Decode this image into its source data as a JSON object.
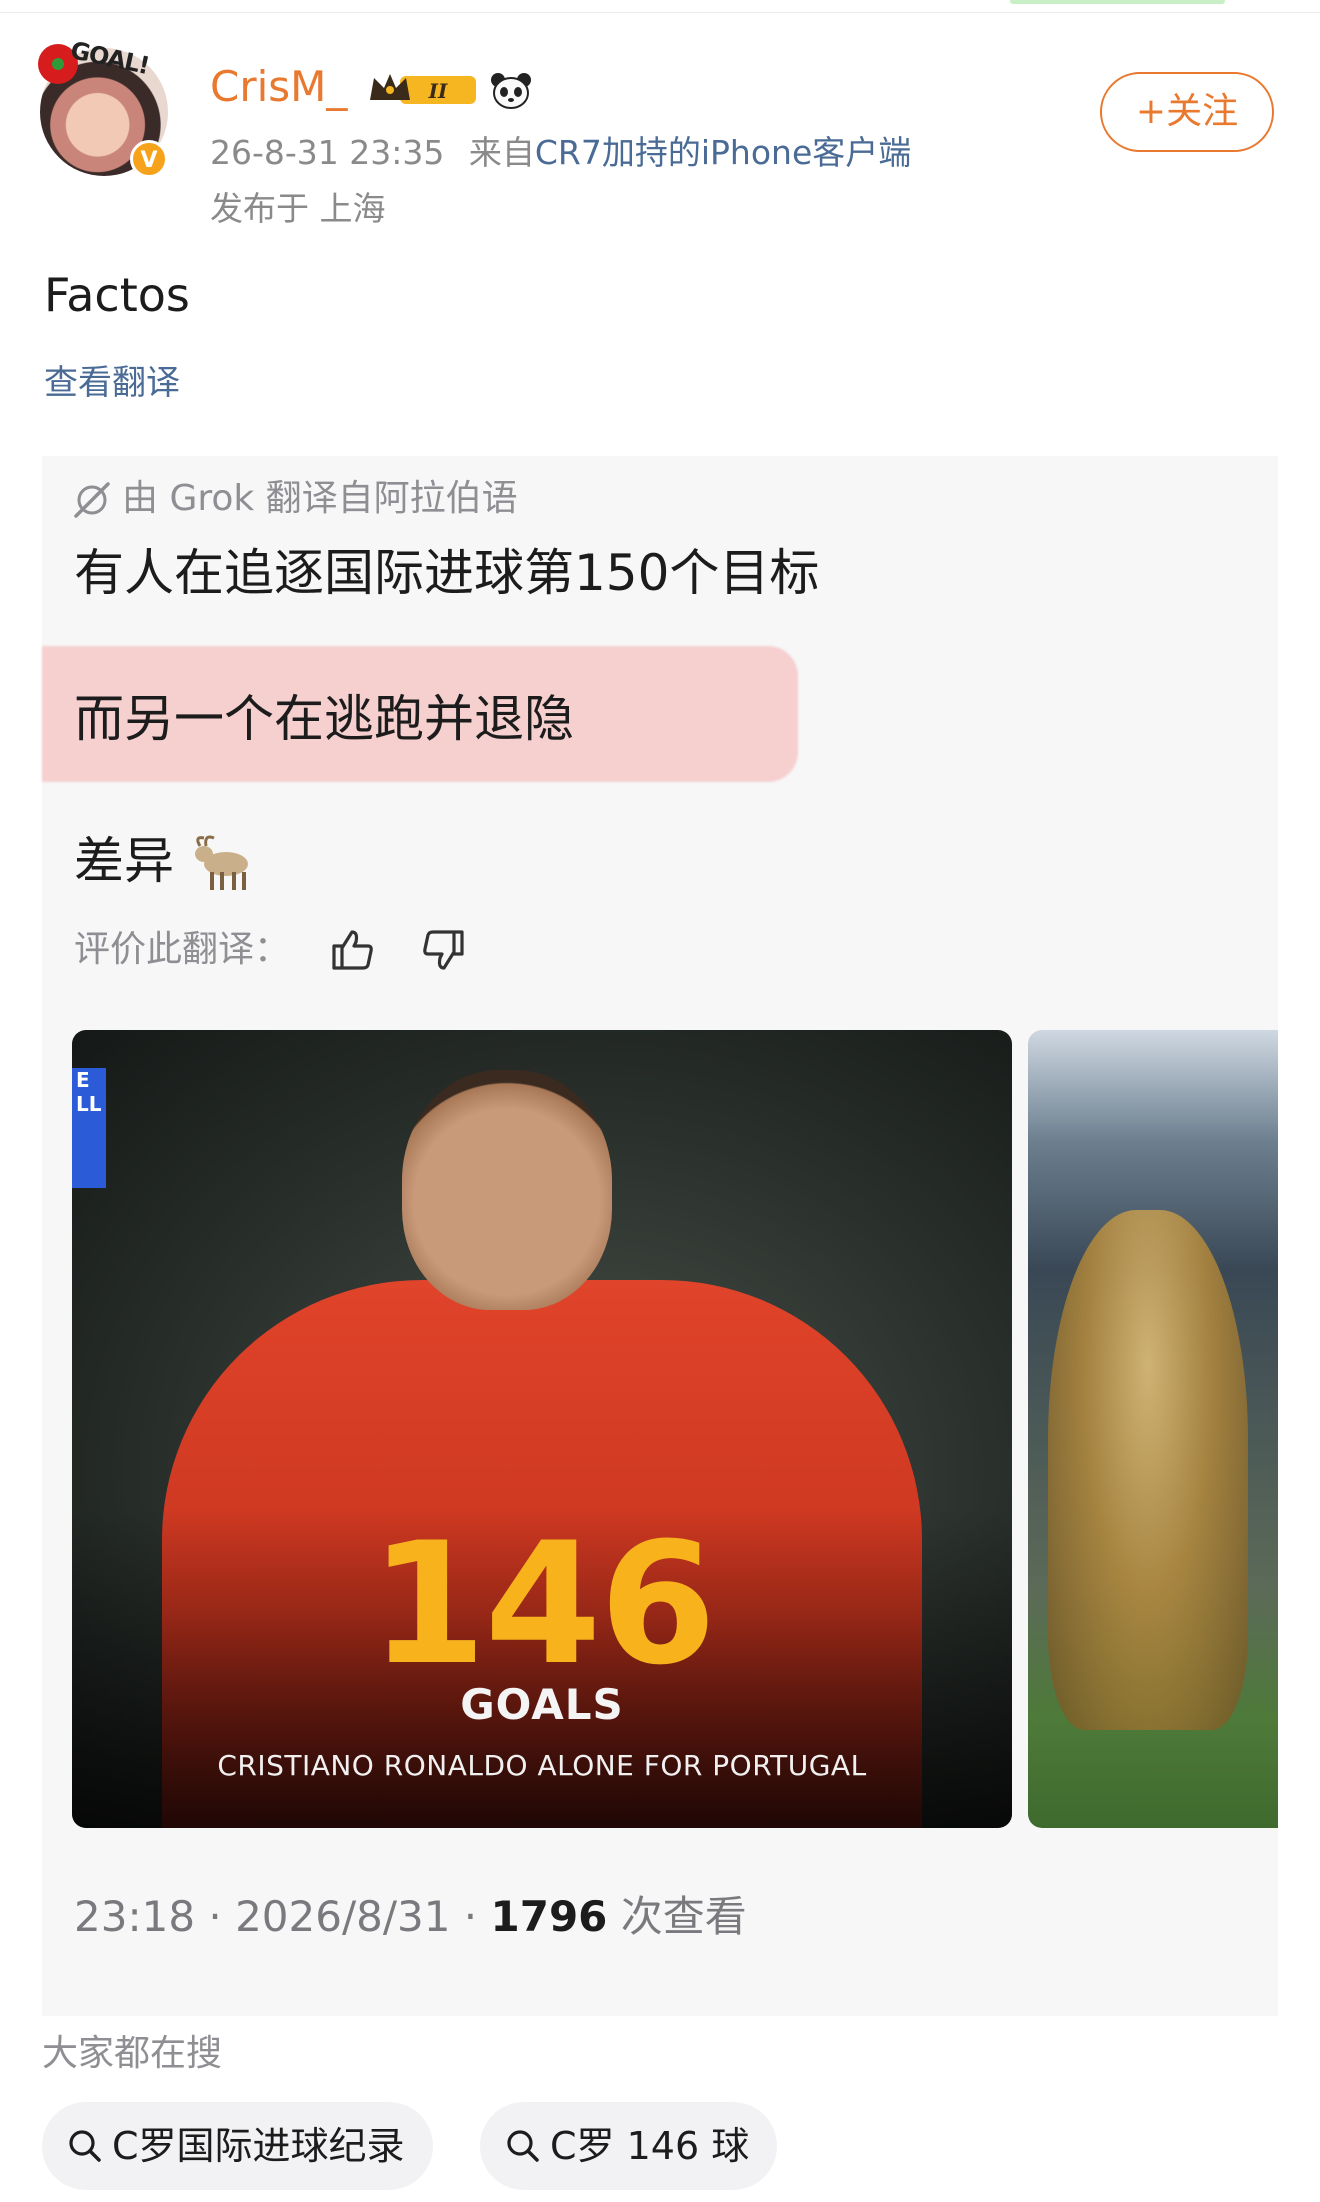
{
  "header": {
    "username": "CrisM_",
    "timestamp": "26-8-31 23:35",
    "source_prefix": "来自",
    "source": "CR7加持的iPhone客户端",
    "location": "发布于 上海",
    "follow_label": "+关注",
    "avatar_sticker": "GOAL!",
    "verified_badge": "V",
    "level_badge": "II"
  },
  "post": {
    "text": "Factos",
    "translate_link": "查看翻译"
  },
  "translation": {
    "source_line": "由 Grok 翻译自阿拉伯语",
    "line1": "有人在追逐国际进球第150个目标",
    "line2": "而另一个在逃跑并退隐",
    "line3": "差异",
    "rate_label": "评价此翻译："
  },
  "image": {
    "corner_tag": "E LL",
    "number": "146",
    "goals_label": "GOALS",
    "caption": "CRISTIANO RONALDO ALONE FOR PORTUGAL"
  },
  "stats": {
    "time": "23:18 · 2026/8/31 · ",
    "views": "1796",
    "views_suffix": " 次查看"
  },
  "search": {
    "label": "大家都在搜",
    "chips": [
      "C罗国际进球纪录",
      "C罗 146 球"
    ]
  },
  "colors": {
    "accent": "#e8792f",
    "link": "#4a6b95",
    "highlight": "#f6cfcf",
    "number": "#f7b21c"
  },
  "icons": [
    "crown-level-badge-icon",
    "panda-icon",
    "grok-logo-icon",
    "goat-emoji-icon",
    "thumb-up-icon",
    "thumb-down-icon",
    "search-icon"
  ]
}
